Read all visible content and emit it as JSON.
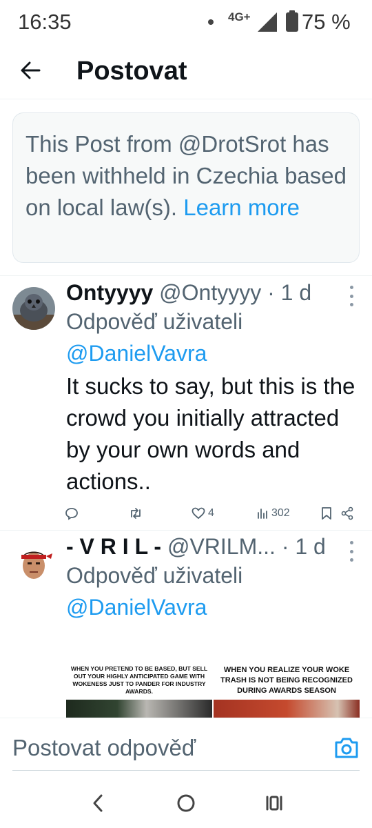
{
  "status_bar": {
    "time": "16:35",
    "network": "4G+",
    "battery_percent": "75 %"
  },
  "header": {
    "title": "Postovat"
  },
  "withheld_notice": {
    "text": "This Post from @DrotSrot has been withheld in Czechia based on local law(s).",
    "link": "Learn more"
  },
  "replies": [
    {
      "name": "Ontyyyy",
      "handle": "@Ontyyyy",
      "time": "· 1 d",
      "reply_to_prefix": "Odpověď uživateli",
      "reply_to_mention": "@DanielVavra",
      "text": "It sucks to say, but this is the crowd you initially attracted by your own words and actions..",
      "likes": "4",
      "views": "302"
    },
    {
      "name": "- V R I L -",
      "handle": "@VRILM...",
      "time": "· 1 d",
      "reply_to_prefix": "Odpověď uživateli",
      "reply_to_mention": "@DanielVavra",
      "meme_left_caption": "WHEN YOU PRETEND TO BE BASED, BUT SELL OUT YOUR HIGHLY ANTICIPATED GAME WITH WOKENESS JUST TO PANDER FOR INDUSTRY AWARDS.",
      "meme_right_caption": "WHEN YOU REALIZE YOUR WOKE TRASH IS NOT BEING RECOGNIZED DURING AWARDS SEASON"
    }
  ],
  "composer": {
    "placeholder": "Postovat odpověď"
  },
  "colors": {
    "accent": "#1d9bf0",
    "secondary_text": "#536471",
    "primary_text": "#0f1419"
  }
}
